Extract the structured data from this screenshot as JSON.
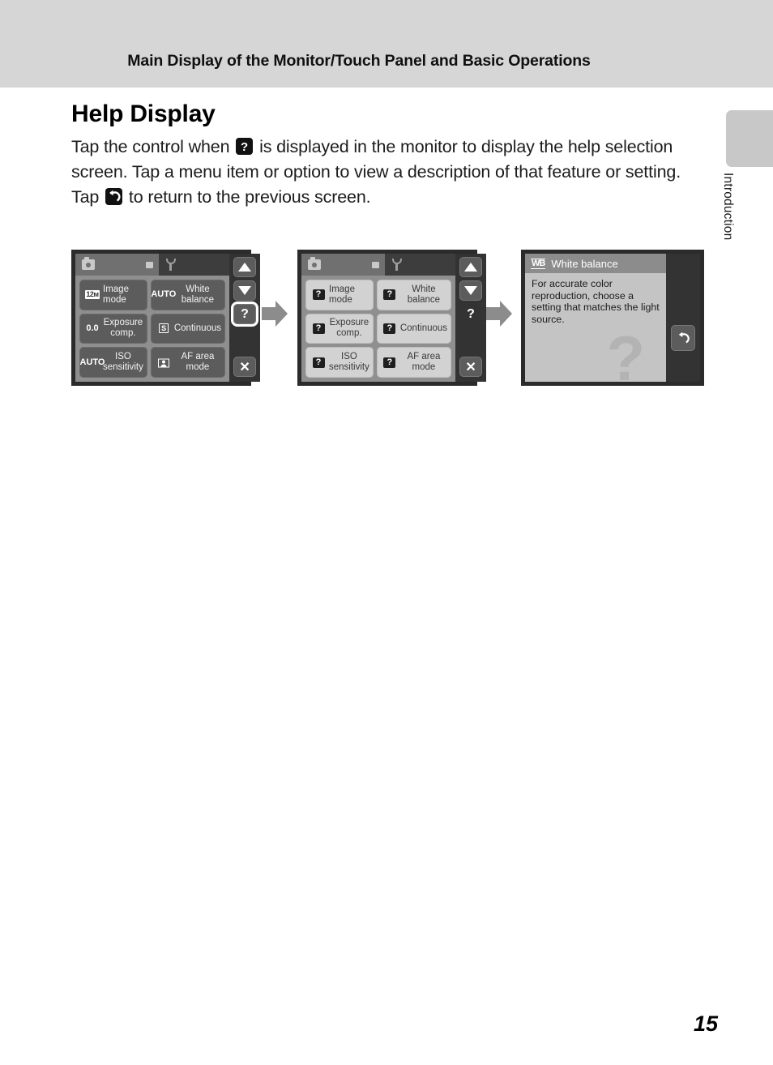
{
  "header": {
    "title": "Main Display of the Monitor/Touch Panel and Basic Operations"
  },
  "side_tab": {
    "label": "Introduction"
  },
  "page": {
    "heading": "Help Display",
    "number": "15"
  },
  "body": {
    "line1_part1": "Tap the control when",
    "line1_icon": "help-question-icon",
    "line1_part2": "is displayed in the monitor to display the help selection screen. Tap a menu item or option to view a description of that feature or setting.",
    "line2_part1": "Tap",
    "line2_icon": "return-arrow-icon",
    "line2_part2": "to return to the previous screen."
  },
  "figure": {
    "arrow_icon": "right-arrow-icon",
    "screens": [
      {
        "id": "shooting-menu-screen",
        "tabs": [
          {
            "icon": "camera-icon",
            "secondary_icon": "movie-icon",
            "state": "active"
          },
          {
            "icon": "wrench-icon",
            "state": "inactive"
          }
        ],
        "menu_items": [
          {
            "icon_text": "12м",
            "icon_style": "chip",
            "label": "Image mode",
            "align": "left"
          },
          {
            "icon_text": "AUTO",
            "icon_style": "plain",
            "label": "White balance",
            "align": "center"
          },
          {
            "icon_text": "0.0",
            "icon_style": "plain",
            "label": "Exposure comp.",
            "align": "center"
          },
          {
            "icon_text": "S",
            "icon_style": "boxed",
            "label": "Continuous",
            "align": "left"
          },
          {
            "icon_text": "AUTO",
            "icon_style": "plain",
            "label": "ISO sensitivity",
            "align": "center"
          },
          {
            "icon_text": "face",
            "icon_style": "face",
            "label": "AF area mode",
            "align": "center"
          }
        ],
        "rail": [
          {
            "icon": "up-arrow-icon",
            "highlighted": false
          },
          {
            "icon": "down-arrow-icon",
            "highlighted": false
          },
          {
            "icon": "help-question-icon",
            "label": "?",
            "highlighted": true
          },
          {
            "icon": "close-x-icon",
            "label": "✕",
            "highlighted": false
          }
        ]
      },
      {
        "id": "help-selection-screen",
        "tabs": [
          {
            "icon": "camera-icon",
            "secondary_icon": "movie-icon",
            "state": "active"
          },
          {
            "icon": "wrench-icon",
            "state": "inactive"
          }
        ],
        "menu_items": [
          {
            "icon_text": "?",
            "icon_style": "qmark",
            "label": "Image mode",
            "align": "left"
          },
          {
            "icon_text": "?",
            "icon_style": "qmark",
            "label": "White balance",
            "align": "center"
          },
          {
            "icon_text": "?",
            "icon_style": "qmark",
            "label": "Exposure comp.",
            "align": "center"
          },
          {
            "icon_text": "?",
            "icon_style": "qmark",
            "label": "Continuous",
            "align": "left"
          },
          {
            "icon_text": "?",
            "icon_style": "qmark",
            "label": "ISO sensitivity",
            "align": "center"
          },
          {
            "icon_text": "?",
            "icon_style": "qmark",
            "label": "AF area mode",
            "align": "center"
          }
        ],
        "rail": [
          {
            "icon": "up-arrow-icon",
            "highlighted": false
          },
          {
            "icon": "down-arrow-icon",
            "highlighted": false
          },
          {
            "icon": "help-question-icon",
            "label": "?",
            "highlighted": false
          },
          {
            "icon": "close-x-icon",
            "label": "✕",
            "highlighted": false
          }
        ]
      },
      {
        "id": "help-description-screen",
        "title_icon": "WB",
        "title": "White balance",
        "description": "For accurate color reproduction, choose a setting that matches the light source.",
        "watermark": "?",
        "rail": [
          {
            "icon": "return-arrow-icon"
          }
        ]
      }
    ]
  }
}
